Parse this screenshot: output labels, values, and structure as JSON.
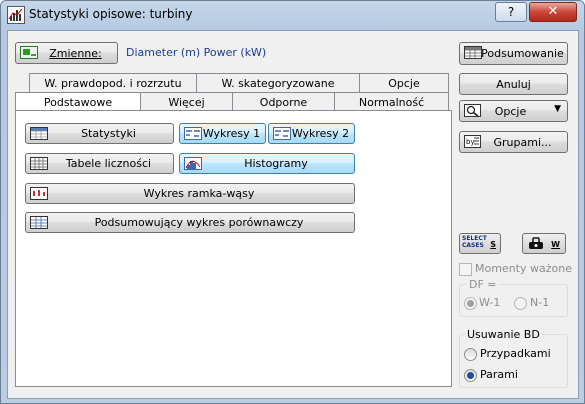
{
  "window": {
    "title": "Statystyki opisowe: turbiny",
    "help_label": "?",
    "close_label": "✕"
  },
  "variables": {
    "button_label": "Zmienne:",
    "value": "Diameter (m) Power (kW)"
  },
  "tabs_row_back": [
    "W. prawdopod. i rozrzutu",
    "W. skategoryzowane",
    "Opcje"
  ],
  "tabs_row_front": [
    "Podstawowe",
    "Więcej",
    "Odporne",
    "Normalność"
  ],
  "panel_buttons": {
    "statystyki": "Statystyki",
    "wykresy1": "Wykresy 1",
    "wykresy2": "Wykresy 2",
    "tabele": "Tabele liczności",
    "histogramy": "Histogramy",
    "ramka": "Wykres ramka-wąsy",
    "porownawczy": "Podsumowujący wykres porównawczy"
  },
  "right_buttons": {
    "podsumowanie": "Podsumowanie",
    "anuluj": "Anuluj",
    "opcje": "Opcje",
    "opcje_arrow": "▼",
    "grupami": "Grupami..."
  },
  "tools": {
    "select_cases_line1": "SELECT",
    "select_cases_line2": "CASES",
    "select_cases_s": "S",
    "weight_w": "W"
  },
  "momenty": {
    "label": "Momenty ważone",
    "checked": false
  },
  "df": {
    "label": "DF =",
    "options": [
      "W-1",
      "N-1"
    ],
    "selected": "W-1"
  },
  "usuwanie": {
    "label": "Usuwanie BD",
    "options": [
      "Przypadkami",
      "Parami"
    ],
    "selected": "Parami"
  }
}
